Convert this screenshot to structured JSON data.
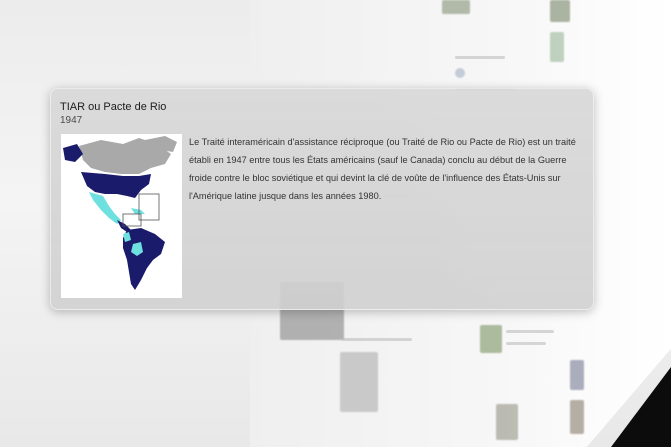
{
  "card": {
    "title": "TIAR ou Pacte de Rio",
    "subtitle": "1947",
    "description": "Le Traité interaméricain d'assistance réciproque (ou Traité de Rio ou Pacte de Rio) est un traité établi en 1947 entre tous les États américains (sauf le Canada) conclu au début de la Guerre froide contre le bloc soviétique et qui devint la clé de voûte de l'influence des États-Unis sur l'Amérique latine jusque dans les années 1980.",
    "map_icon": "americas-map-image"
  },
  "colors": {
    "member_dark": "#1b1b6b",
    "member_light": "#6fe0e0",
    "non_member": "#a9a9a9"
  }
}
